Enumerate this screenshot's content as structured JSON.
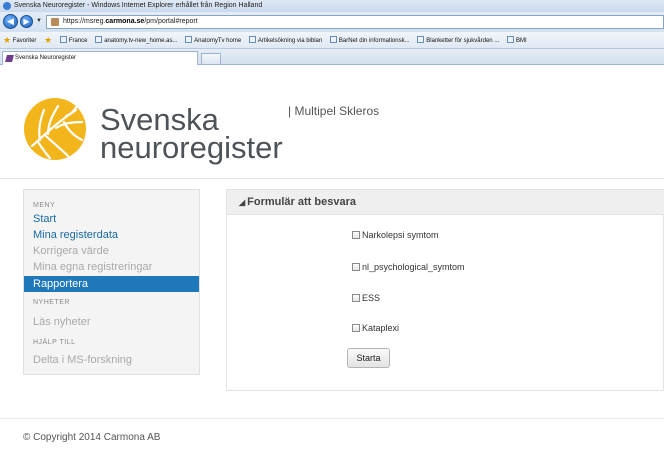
{
  "browser": {
    "window_title": "Svenska Neuroregister - Windows Internet Explorer erhållet från Region Halland",
    "url_prefix": "https://msreg.",
    "url_domain": "carmona.se",
    "url_path": "/pm/portal#report",
    "favorites_label": "Favoriter",
    "bookmarks": [
      "France",
      "anatomy.tv-new_home.as...",
      "AnatomyTv home",
      "Artikelsökning via biblan",
      "BarNet din informationsk...",
      "Blanketter för sjukvården ...",
      "BMI"
    ],
    "tab_title": "Svenska Neuroregister"
  },
  "header": {
    "brand_line1": "Svenska",
    "brand_line2": "neuroregister",
    "subtitle": "| Multipel Skleros"
  },
  "sidebar": {
    "menu_heading": "MENY",
    "menu_items": [
      {
        "label": "Start",
        "state": "link"
      },
      {
        "label": "Mina registerdata",
        "state": "link"
      },
      {
        "label": "Korrigera värde",
        "state": "disabled"
      },
      {
        "label": "Mina egna registreringar",
        "state": "disabled"
      },
      {
        "label": "Rapportera",
        "state": "active"
      }
    ],
    "news_heading": "NYHETER",
    "news_item": "Läs nyheter",
    "help_heading": "HJÄLP TILL",
    "help_item": "Delta i MS-forskning"
  },
  "panel": {
    "title": "Formulär att besvara",
    "options": [
      {
        "label": "Narkolepsi symtom",
        "checked": false
      },
      {
        "label": "nl_psychological_symtom",
        "checked": false
      },
      {
        "label": "ESS",
        "checked": false
      },
      {
        "label": "Kataplexi",
        "checked": false
      }
    ],
    "start_button": "Starta"
  },
  "footer": {
    "copyright": "© Copyright 2014 Carmona AB"
  },
  "colors": {
    "active_menu": "#1f78b9",
    "link": "#1b6aa5",
    "logo_yellow": "#f2b51c"
  }
}
